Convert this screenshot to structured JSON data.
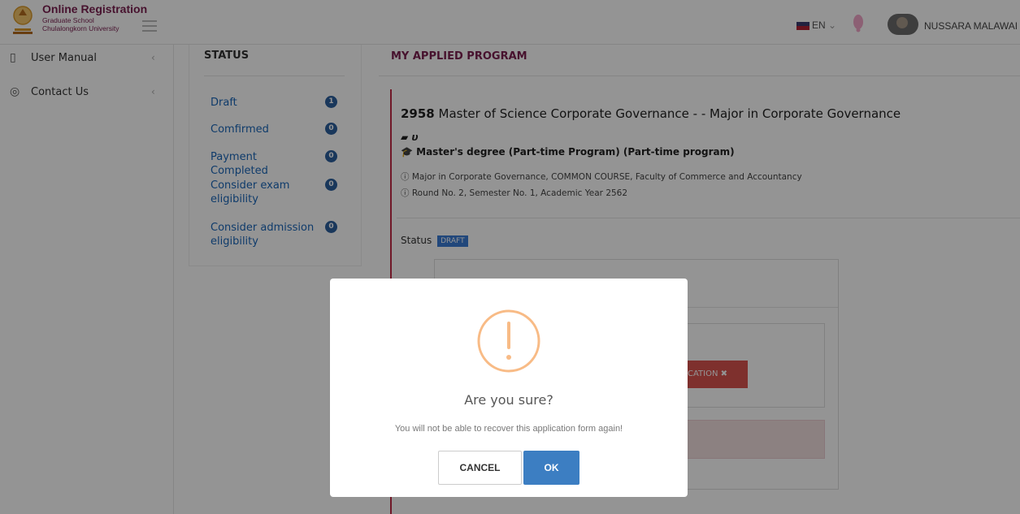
{
  "header": {
    "brand_title": "Online Registration",
    "brand_sub1": "Graduate School",
    "brand_sub2": "Chulalongkorn University",
    "language": "EN",
    "user_name": "NUSSARA MALAWAI"
  },
  "sidebar": {
    "items": [
      {
        "label": "User Manual"
      },
      {
        "label": "Contact Us"
      }
    ]
  },
  "status_panel": {
    "title": "STATUS",
    "items": [
      {
        "label": "Draft",
        "count": "1"
      },
      {
        "label": "Comfirmed",
        "count": "0"
      },
      {
        "label": "Payment Completed",
        "count": "0"
      },
      {
        "label": "Consider exam eligibility",
        "count": "0"
      },
      {
        "label": "Consider admission eligibility",
        "count": "0"
      }
    ]
  },
  "main": {
    "title": "MY APPLIED PROGRAM",
    "program_code": "2958",
    "program_name": "Master of Science Corporate Governance - - Major in Corporate Governance",
    "book_line": "υ",
    "degree": "Master's degree (Part-time Program) (Part-time program)",
    "info1": "Major in Corporate Governance, COMMON COURSE, Faculty of Commerce and Accountancy",
    "info2": "Round No. 2, Semester No. 1, Academic Year 2562",
    "status_label": "Status",
    "status_value": "DRAFT",
    "cancel_application_partial": "CATION ✖"
  },
  "modal": {
    "title": "Are you sure?",
    "text": "You will not be able to recover this application form again!",
    "cancel_label": "CANCEL",
    "ok_label": "OK",
    "warning_color": "#f8bb86"
  }
}
